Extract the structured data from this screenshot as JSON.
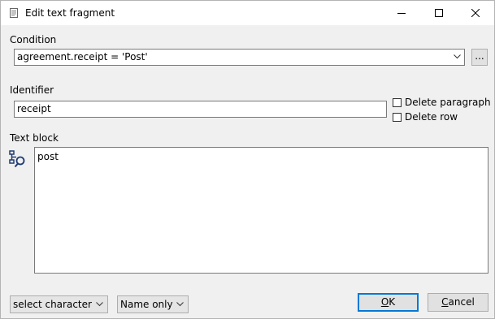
{
  "window": {
    "title": "Edit text fragment",
    "icon": "document-icon"
  },
  "condition": {
    "label": "Condition",
    "value": "agreement.receipt = 'Post'",
    "browse_label": "..."
  },
  "identifier": {
    "label": "Identifier",
    "value": "receipt"
  },
  "options": {
    "delete_paragraph": "Delete paragraph",
    "delete_row": "Delete row"
  },
  "text_block": {
    "label": "Text block",
    "content": "post",
    "tool_icon": "field-browser-icon"
  },
  "footer": {
    "character_select": "select character",
    "name_mode": "Name only",
    "ok_label_rest": "K",
    "ok_label_mnemonic": "O",
    "cancel_label_mnemonic": "C",
    "cancel_label_rest": "ancel"
  }
}
